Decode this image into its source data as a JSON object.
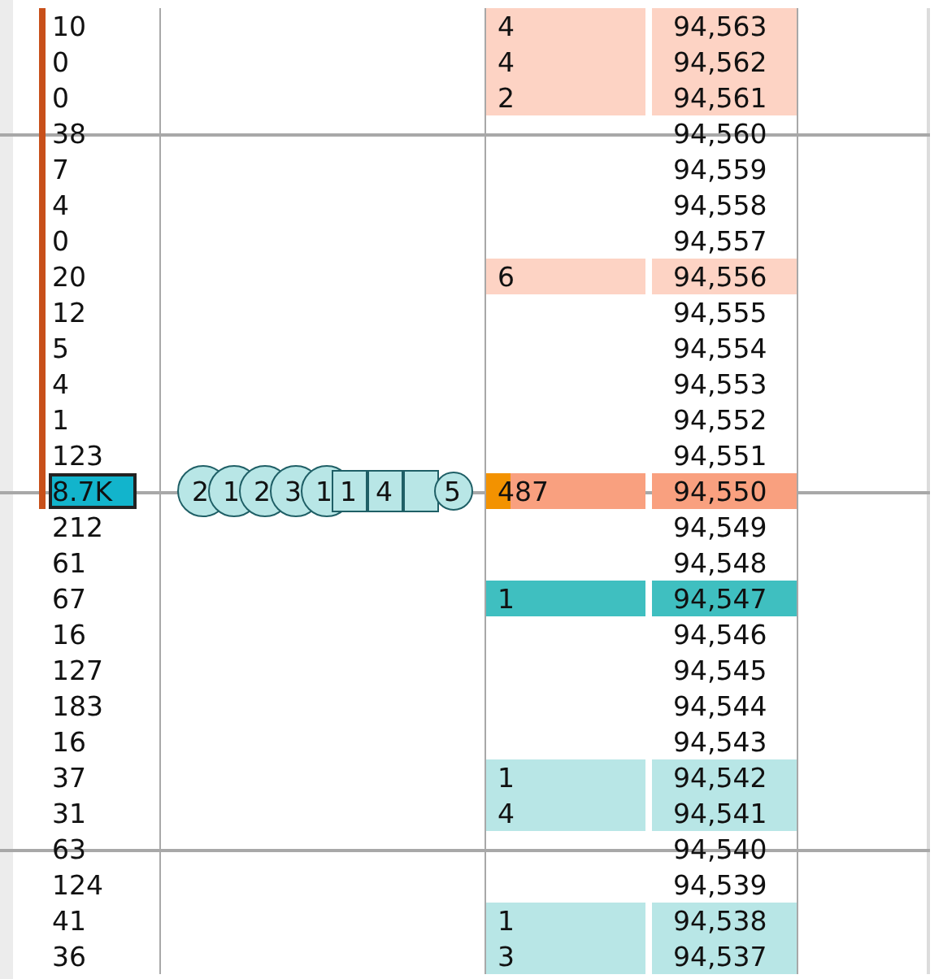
{
  "ladder": {
    "rows": [
      {
        "volume": "10",
        "size": "4",
        "price": "94,563",
        "kind": "ask",
        "best": false,
        "in_range": true,
        "highlight": false,
        "gridline": false
      },
      {
        "volume": "0",
        "size": "4",
        "price": "94,562",
        "kind": "ask",
        "best": false,
        "in_range": true,
        "highlight": false,
        "gridline": false
      },
      {
        "volume": "0",
        "size": "2",
        "price": "94,561",
        "kind": "ask",
        "best": false,
        "in_range": true,
        "highlight": false,
        "gridline": false
      },
      {
        "volume": "38",
        "price": "94,560",
        "kind": "empty",
        "in_range": true,
        "highlight": false,
        "gridline": true
      },
      {
        "volume": "7",
        "price": "94,559",
        "kind": "empty",
        "in_range": true,
        "highlight": false,
        "gridline": false
      },
      {
        "volume": "4",
        "price": "94,558",
        "kind": "empty",
        "in_range": true,
        "highlight": false,
        "gridline": false
      },
      {
        "volume": "0",
        "price": "94,557",
        "kind": "empty",
        "in_range": true,
        "highlight": false,
        "gridline": false
      },
      {
        "volume": "20",
        "size": "6",
        "price": "94,556",
        "kind": "ask",
        "best": false,
        "in_range": true,
        "highlight": false,
        "gridline": false
      },
      {
        "volume": "12",
        "price": "94,555",
        "kind": "empty",
        "in_range": true,
        "highlight": false,
        "gridline": false
      },
      {
        "volume": "5",
        "price": "94,554",
        "kind": "empty",
        "in_range": true,
        "highlight": false,
        "gridline": false
      },
      {
        "volume": "4",
        "price": "94,553",
        "kind": "empty",
        "in_range": true,
        "highlight": false,
        "gridline": false
      },
      {
        "volume": "1",
        "price": "94,552",
        "kind": "empty",
        "in_range": true,
        "highlight": false,
        "gridline": false
      },
      {
        "volume": "123",
        "price": "94,551",
        "kind": "empty",
        "in_range": true,
        "highlight": false,
        "gridline": false
      },
      {
        "volume": "8.7K",
        "size": "487",
        "price": "94,550",
        "kind": "ask",
        "best": true,
        "in_range": true,
        "highlight": true,
        "gridline": true,
        "trades": [
          {
            "kind": "circle",
            "text": "2"
          },
          {
            "kind": "circle",
            "text": "1"
          },
          {
            "kind": "circle",
            "text": "2"
          },
          {
            "kind": "circle",
            "text": "3"
          },
          {
            "kind": "circle",
            "text": "1"
          },
          {
            "kind": "square",
            "text": "1"
          },
          {
            "kind": "square",
            "text": "4"
          },
          {
            "kind": "square"
          },
          {
            "kind": "circle",
            "text": "5"
          }
        ]
      },
      {
        "volume": "212",
        "price": "94,549",
        "kind": "empty",
        "in_range": false,
        "highlight": false,
        "gridline": false
      },
      {
        "volume": "61",
        "price": "94,548",
        "kind": "empty",
        "in_range": false,
        "highlight": false,
        "gridline": false
      },
      {
        "volume": "67",
        "size": "1",
        "price": "94,547",
        "kind": "bid",
        "best": true,
        "in_range": false,
        "highlight": false,
        "gridline": false
      },
      {
        "volume": "16",
        "price": "94,546",
        "kind": "empty",
        "in_range": false,
        "highlight": false,
        "gridline": false
      },
      {
        "volume": "127",
        "price": "94,545",
        "kind": "empty",
        "in_range": false,
        "highlight": false,
        "gridline": false
      },
      {
        "volume": "183",
        "price": "94,544",
        "kind": "empty",
        "in_range": false,
        "highlight": false,
        "gridline": false
      },
      {
        "volume": "16",
        "price": "94,543",
        "kind": "empty",
        "in_range": false,
        "highlight": false,
        "gridline": false
      },
      {
        "volume": "37",
        "size": "1",
        "price": "94,542",
        "kind": "bid",
        "best": false,
        "in_range": false,
        "highlight": false,
        "gridline": false
      },
      {
        "volume": "31",
        "size": "4",
        "price": "94,541",
        "kind": "bid",
        "best": false,
        "in_range": false,
        "highlight": false,
        "gridline": false
      },
      {
        "volume": "63",
        "price": "94,540",
        "kind": "empty",
        "in_range": false,
        "highlight": false,
        "gridline": true
      },
      {
        "volume": "124",
        "price": "94,539",
        "kind": "empty",
        "in_range": false,
        "highlight": false,
        "gridline": false
      },
      {
        "volume": "41",
        "size": "1",
        "price": "94,538",
        "kind": "bid",
        "best": false,
        "in_range": false,
        "highlight": false,
        "gridline": false
      },
      {
        "volume": "36",
        "size": "3",
        "price": "94,537",
        "kind": "bid",
        "best": false,
        "in_range": false,
        "highlight": false,
        "gridline": false
      }
    ]
  }
}
